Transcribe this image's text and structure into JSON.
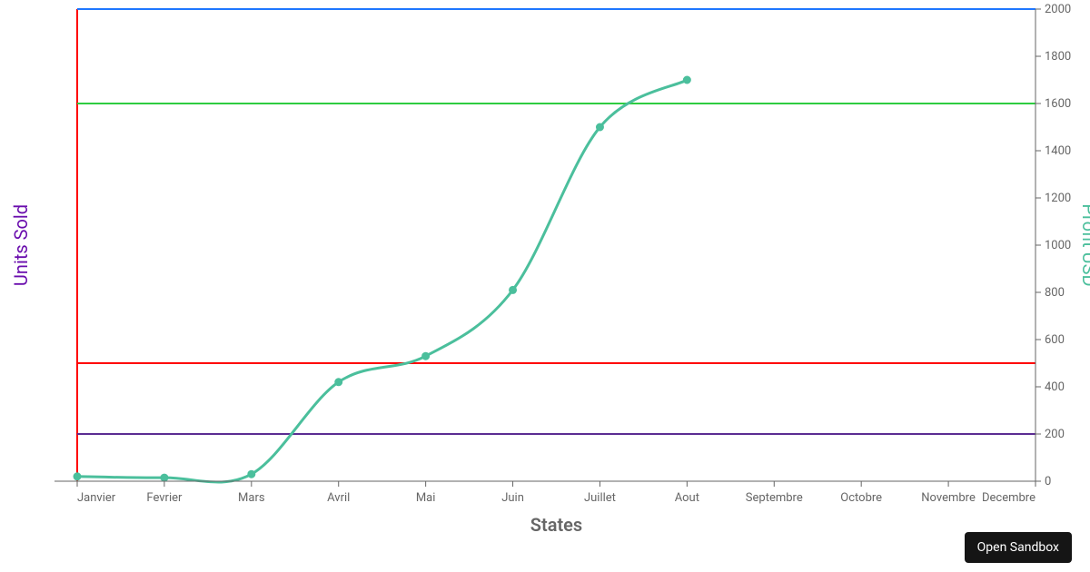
{
  "sandbox_button": "Open Sandbox",
  "axes": {
    "x_title": "States",
    "y_left_title": "Units Sold",
    "y_right_title": "Profit USD"
  },
  "chart_data": {
    "type": "line",
    "categories": [
      "Janvier",
      "Fevrier",
      "Mars",
      "Avril",
      "Mai",
      "Juin",
      "Juillet",
      "Aout",
      "Septembre",
      "Octobre",
      "Novembre",
      "Decembre"
    ],
    "series": [
      {
        "name": "Profit USD",
        "color": "#4bbf9c",
        "values": [
          20,
          15,
          30,
          420,
          530,
          810,
          1500,
          1700
        ]
      }
    ],
    "reference_lines": [
      {
        "value": 2000,
        "color": "#1f77ff"
      },
      {
        "value": 1600,
        "color": "#2ecc40"
      },
      {
        "value": 500,
        "color": "#ff0000"
      },
      {
        "value": 200,
        "color": "#5b2c92"
      }
    ],
    "y_axis_right": {
      "min": 0,
      "max": 2000,
      "ticks": [
        0,
        200,
        400,
        600,
        800,
        1000,
        1200,
        1400,
        1600,
        1800,
        2000
      ]
    },
    "y_axis_left_visible": false,
    "xlabel": "States",
    "title": ""
  },
  "colors": {
    "left_axis_label": "#6a0dad",
    "right_axis_label": "#4bbf9c",
    "left_red_border": "#ff0000"
  }
}
